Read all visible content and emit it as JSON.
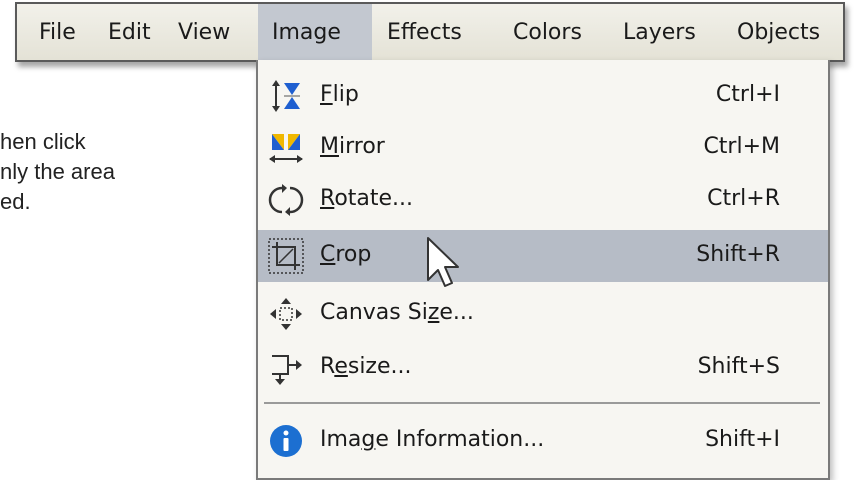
{
  "background_text": [
    "hen click",
    "nly the area",
    "ed."
  ],
  "menubar": {
    "items": [
      "File",
      "Edit",
      "View",
      "Image",
      "Effects",
      "Colors",
      "Layers",
      "Objects"
    ],
    "active_index": 3
  },
  "dropdown": {
    "items": [
      {
        "pre": "",
        "ul": "F",
        "post": "lip",
        "shortcut": "Ctrl+I",
        "icon": "flip-icon"
      },
      {
        "pre": "",
        "ul": "M",
        "post": "irror",
        "shortcut": "Ctrl+M",
        "icon": "mirror-icon"
      },
      {
        "pre": "",
        "ul": "R",
        "post": "otate...",
        "shortcut": "Ctrl+R",
        "icon": "rotate-icon"
      },
      {
        "pre": "",
        "ul": "C",
        "post": "rop",
        "shortcut": "Shift+R",
        "icon": "crop-icon",
        "selected": true
      },
      {
        "pre": "Canvas Si",
        "ul": "z",
        "post": "e...",
        "shortcut": "",
        "icon": "canvas-size-icon"
      },
      {
        "pre": "R",
        "ul": "e",
        "post": "size...",
        "shortcut": "Shift+S",
        "icon": "resize-icon"
      },
      {
        "pre": "Ima",
        "ul": "g",
        "post": "e Information...",
        "shortcut": "Shift+I",
        "icon": "info-icon"
      }
    ]
  },
  "colors": {
    "menubar_bg": "#e8e6dc",
    "active_bg": "#c3c8d0",
    "selected_bg": "#b6bcc6",
    "flip_blue": "#1f5fd0",
    "mirror_yellow": "#f0b800",
    "info_blue": "#1c6fd1"
  }
}
